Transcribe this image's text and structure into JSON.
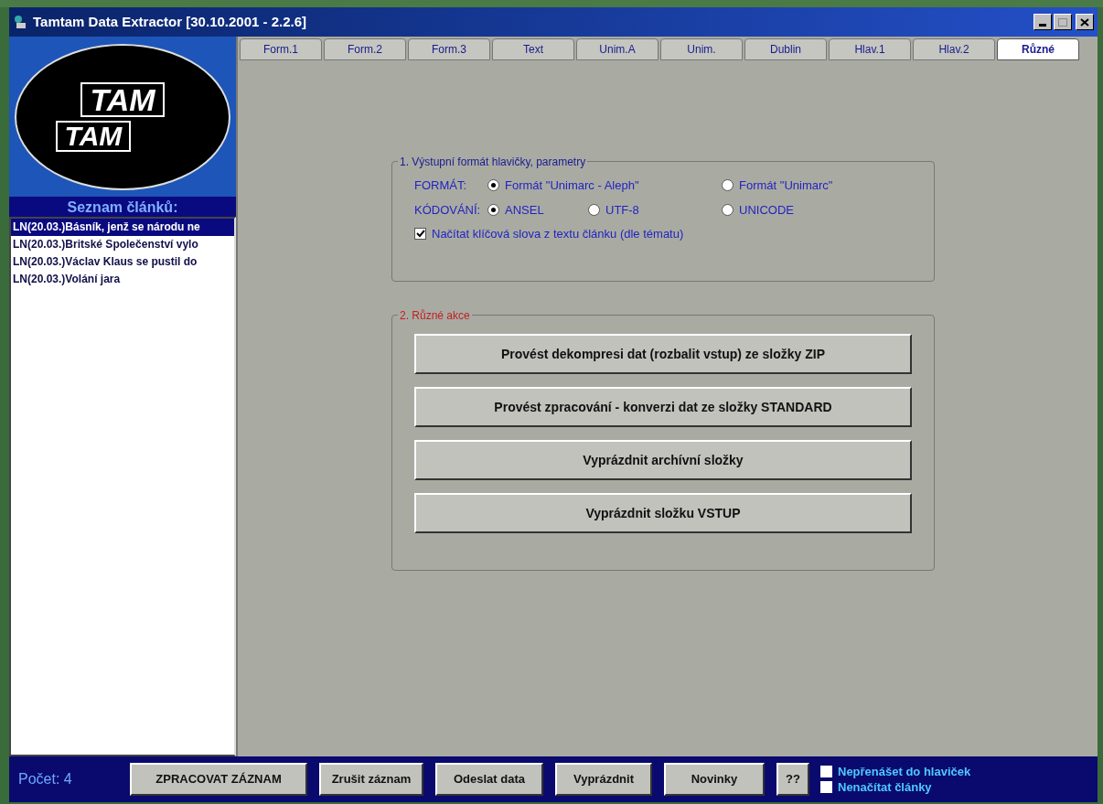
{
  "window": {
    "title": "Tamtam Data Extractor [30.10.2001 - 2.2.6]"
  },
  "logo": {
    "words": [
      "TAM",
      "TAM"
    ]
  },
  "sidebar": {
    "title": "Seznam článků:",
    "items": [
      {
        "label": "LN(20.03.)Básník, jenž se národu ne",
        "selected": true
      },
      {
        "label": "LN(20.03.)Britské Společenství vylo",
        "selected": false
      },
      {
        "label": "LN(20.03.)Václav Klaus se pustil do",
        "selected": false
      },
      {
        "label": "LN(20.03.)Volání jara",
        "selected": false
      }
    ]
  },
  "tabs": [
    {
      "label": "Form.1",
      "selected": false
    },
    {
      "label": "Form.2",
      "selected": false
    },
    {
      "label": "Form.3",
      "selected": false
    },
    {
      "label": "Text",
      "selected": false
    },
    {
      "label": "Unim.A",
      "selected": false
    },
    {
      "label": "Unim.",
      "selected": false
    },
    {
      "label": "Dublin",
      "selected": false
    },
    {
      "label": "Hlav.1",
      "selected": false
    },
    {
      "label": "Hlav.2",
      "selected": false
    },
    {
      "label": "Různé",
      "selected": true
    }
  ],
  "group1": {
    "title": "1. Výstupní formát hlavičky, parametry",
    "format": {
      "label": "FORMÁT:",
      "options": [
        {
          "label": "Formát \"Unimarc - Aleph\"",
          "selected": true
        },
        {
          "label": "Formát \"Unimarc\"",
          "selected": false
        }
      ]
    },
    "encoding": {
      "label": "KÓDOVÁNÍ:",
      "options": [
        {
          "label": "ANSEL",
          "selected": true
        },
        {
          "label": "UTF-8",
          "selected": false
        },
        {
          "label": "UNICODE",
          "selected": false
        }
      ]
    },
    "checkbox": {
      "label": "Načítat klíčová slova z textu článku (dle tématu)",
      "checked": true
    }
  },
  "group2": {
    "title": "2. Různé akce",
    "buttons": [
      "Provést dekompresi dat (rozbalit vstup) ze složky ZIP",
      "Provést zpracování - konverzi dat ze složky STANDARD",
      "Vyprázdnit archívní složky",
      "Vyprázdnit složku VSTUP"
    ]
  },
  "bottom_bar": {
    "count": "Počet: 4",
    "buttons": [
      "ZPRACOVAT ZÁZNAM",
      "Zrušit záznam",
      "Odeslat data",
      "Vyprázdnit",
      "Novinky",
      "??"
    ],
    "checkboxes": [
      {
        "label": "Nepřenášet do hlaviček",
        "checked": false
      },
      {
        "label": "Nenačítat články",
        "checked": false
      }
    ]
  }
}
